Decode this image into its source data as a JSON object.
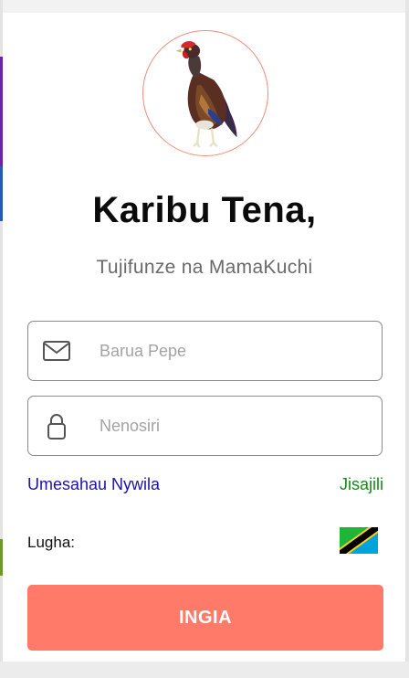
{
  "header": {
    "title": "Karibu Tena,",
    "subtitle": "Tujifunze na MamaKuchi"
  },
  "logo": {
    "icon": "rooster-logo"
  },
  "form": {
    "email": {
      "placeholder": "Barua Pepe",
      "value": "",
      "icon": "mail-icon"
    },
    "password": {
      "placeholder": "Nenosiri",
      "value": "",
      "icon": "lock-icon"
    }
  },
  "links": {
    "forgot_password": "Umesahau Nywila",
    "register": "Jisajili"
  },
  "language": {
    "label": "Lugha:",
    "flag": "tanzania-flag-icon"
  },
  "actions": {
    "login_label": "INGIA"
  },
  "colors": {
    "accent": "#ff7a69",
    "link_blue": "#1d14a3",
    "link_green": "#138a17"
  }
}
